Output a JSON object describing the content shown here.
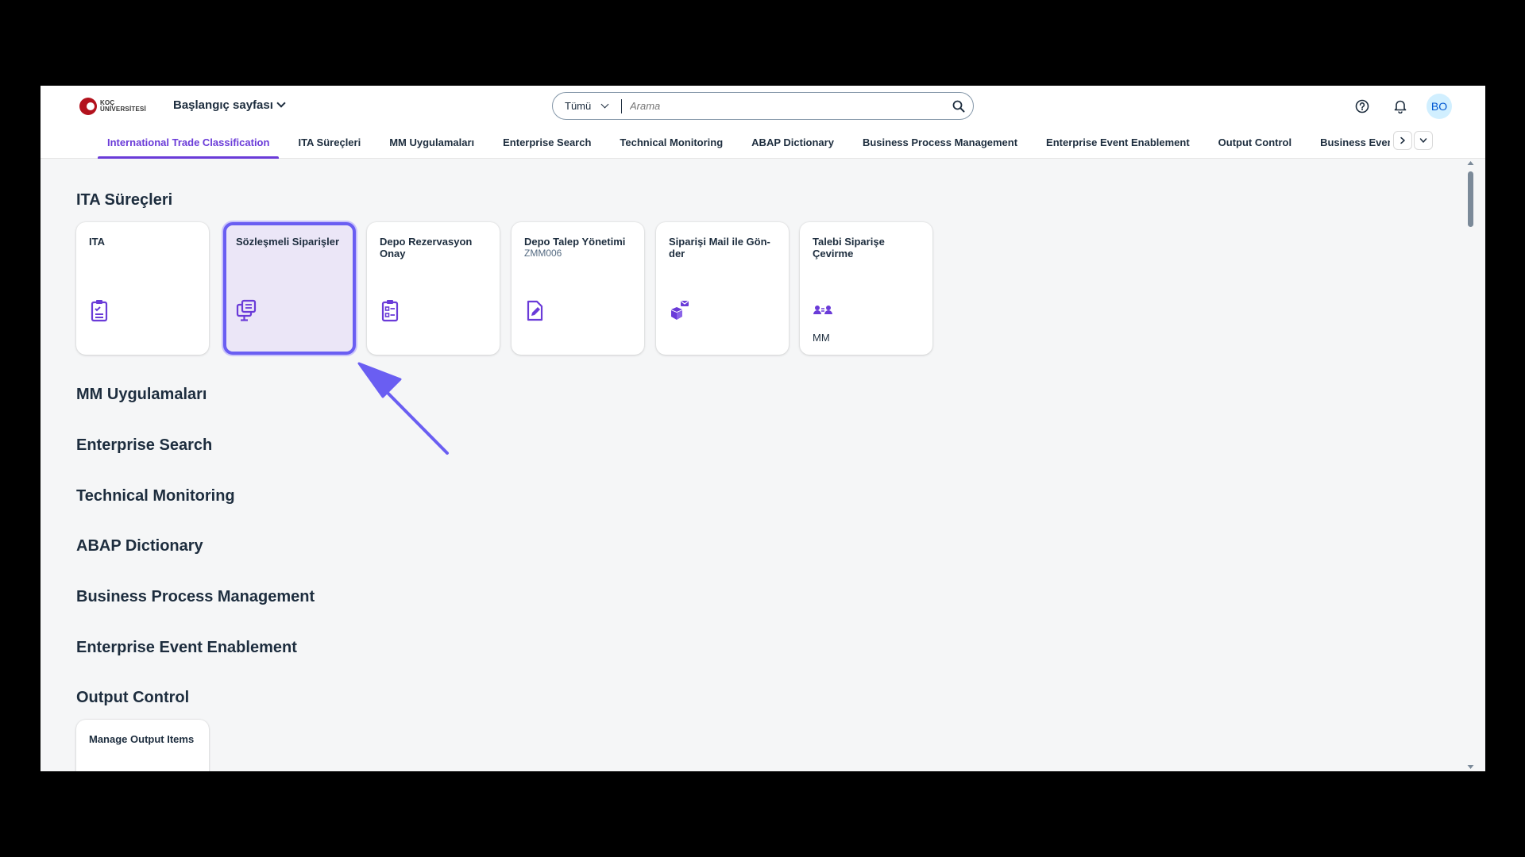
{
  "logo": {
    "line1": "KOÇ",
    "line2": "ÜNİVERSİTESİ"
  },
  "header": {
    "home_label": "Başlangıç sayfası",
    "search": {
      "scope": "Tümü",
      "placeholder": "Arama"
    },
    "avatar_initials": "BO"
  },
  "tabs": [
    {
      "label": "International Trade Classification",
      "active": true
    },
    {
      "label": "ITA Süreçleri"
    },
    {
      "label": "MM Uygulamaları"
    },
    {
      "label": "Enterprise Search"
    },
    {
      "label": "Technical Monitoring"
    },
    {
      "label": "ABAP Dictionary"
    },
    {
      "label": "Business Process Management"
    },
    {
      "label": "Enterprise Event Enablement"
    },
    {
      "label": "Output Control"
    },
    {
      "label": "Business Event Ha"
    }
  ],
  "sections": {
    "ita": "ITA Süreçleri",
    "mm": "MM Uygulamaları",
    "search": "Enterprise Search",
    "monitoring": "Technical Monitoring",
    "abap": "ABAP Dictionary",
    "bpm": "Business Process Management",
    "eee": "Enterprise Event Enablement",
    "output": "Output Control"
  },
  "ita_tiles": [
    {
      "title": "ITA",
      "subtitle": "",
      "footer": "",
      "icon": "checklist-icon"
    },
    {
      "title": "Sözleşmeli Siparişler",
      "subtitle": "",
      "footer": "",
      "icon": "monitor-copy-icon"
    },
    {
      "title": "Depo Rezervasyon Onay",
      "subtitle": "",
      "footer": "",
      "icon": "task-list-icon"
    },
    {
      "title": "Depo Talep Yönetimi",
      "subtitle": "ZMM006",
      "footer": "",
      "icon": "edit-document-icon"
    },
    {
      "title": "Siparişi Mail ile Gön-der",
      "subtitle": "",
      "footer": "",
      "icon": "box-mail-icon"
    },
    {
      "title": "Talebi Siparişe Çevirme",
      "subtitle": "",
      "footer": "MM",
      "icon": "people-swap-icon"
    }
  ],
  "output_tiles": [
    {
      "title": "Manage Output Items"
    }
  ],
  "colors": {
    "accent": "#6a3bd8",
    "selected_border": "#6a5ef2",
    "selected_bg": "#ebe6f7",
    "icon": "#6a3bd8"
  }
}
